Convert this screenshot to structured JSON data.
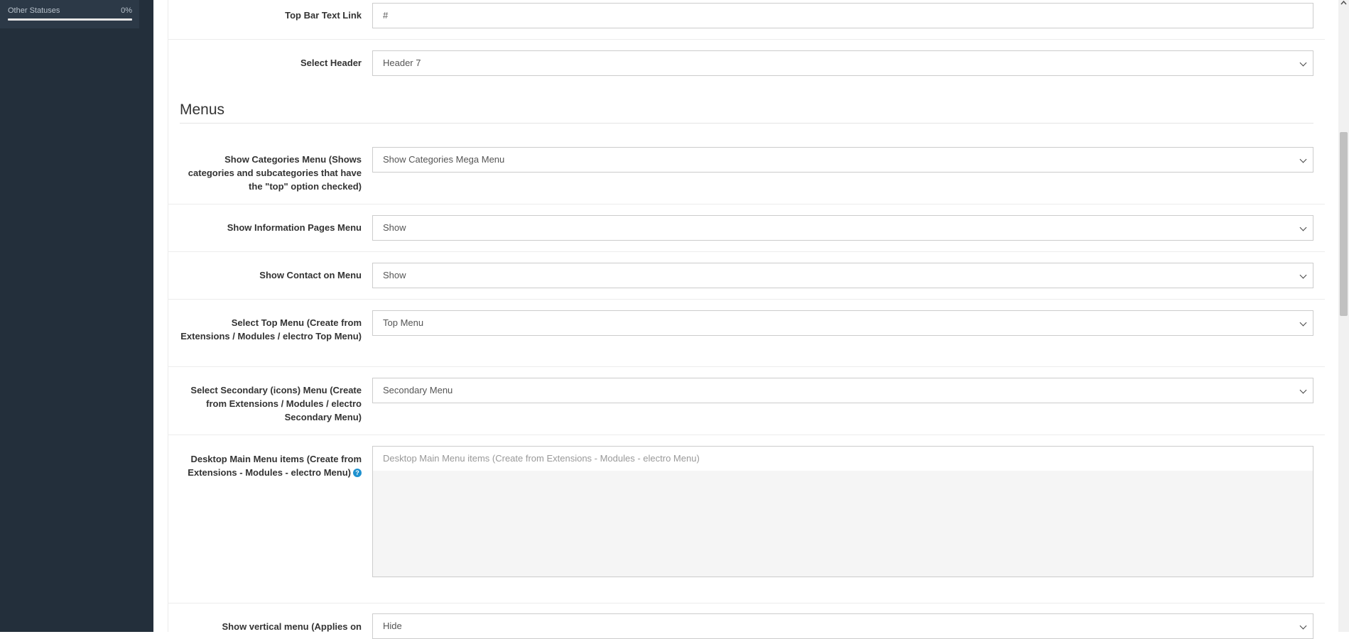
{
  "sidebar": {
    "stat": {
      "label": "Other Statuses",
      "value": "0%",
      "progress_percent": 0
    }
  },
  "form": {
    "top_bar_text_link": {
      "label": "Top Bar Text Link",
      "value": "#"
    },
    "select_header": {
      "label": "Select Header",
      "value": "Header 7"
    },
    "menus_title": "Menus",
    "show_categories_menu": {
      "label": "Show Categories Menu (Shows categories and subcategories that have the \"top\" option checked)",
      "value": "Show Categories Mega Menu"
    },
    "show_information_pages_menu": {
      "label": "Show Information Pages Menu",
      "value": "Show"
    },
    "show_contact_on_menu": {
      "label": "Show Contact on Menu",
      "value": "Show"
    },
    "select_top_menu": {
      "label": "Select Top Menu (Create from Extensions / Modules / electro Top Menu)",
      "value": "Top Menu"
    },
    "select_secondary_menu": {
      "label": "Select Secondary (icons) Menu (Create from Extensions / Modules / electro Secondary Menu)",
      "value": "Secondary Menu"
    },
    "desktop_main_menu_items": {
      "label": "Desktop Main Menu items (Create from Extensions - Modules - electro Menu)",
      "placeholder": "Desktop Main Menu items (Create from Extensions - Modules - electro Menu)",
      "help_icon": "question-circle-icon"
    },
    "show_vertical_menu": {
      "label": "Show vertical menu (Applies on",
      "value": "Hide"
    }
  },
  "colors": {
    "sidebar_bg": "#232f3b",
    "accent": "#1e91cf"
  }
}
